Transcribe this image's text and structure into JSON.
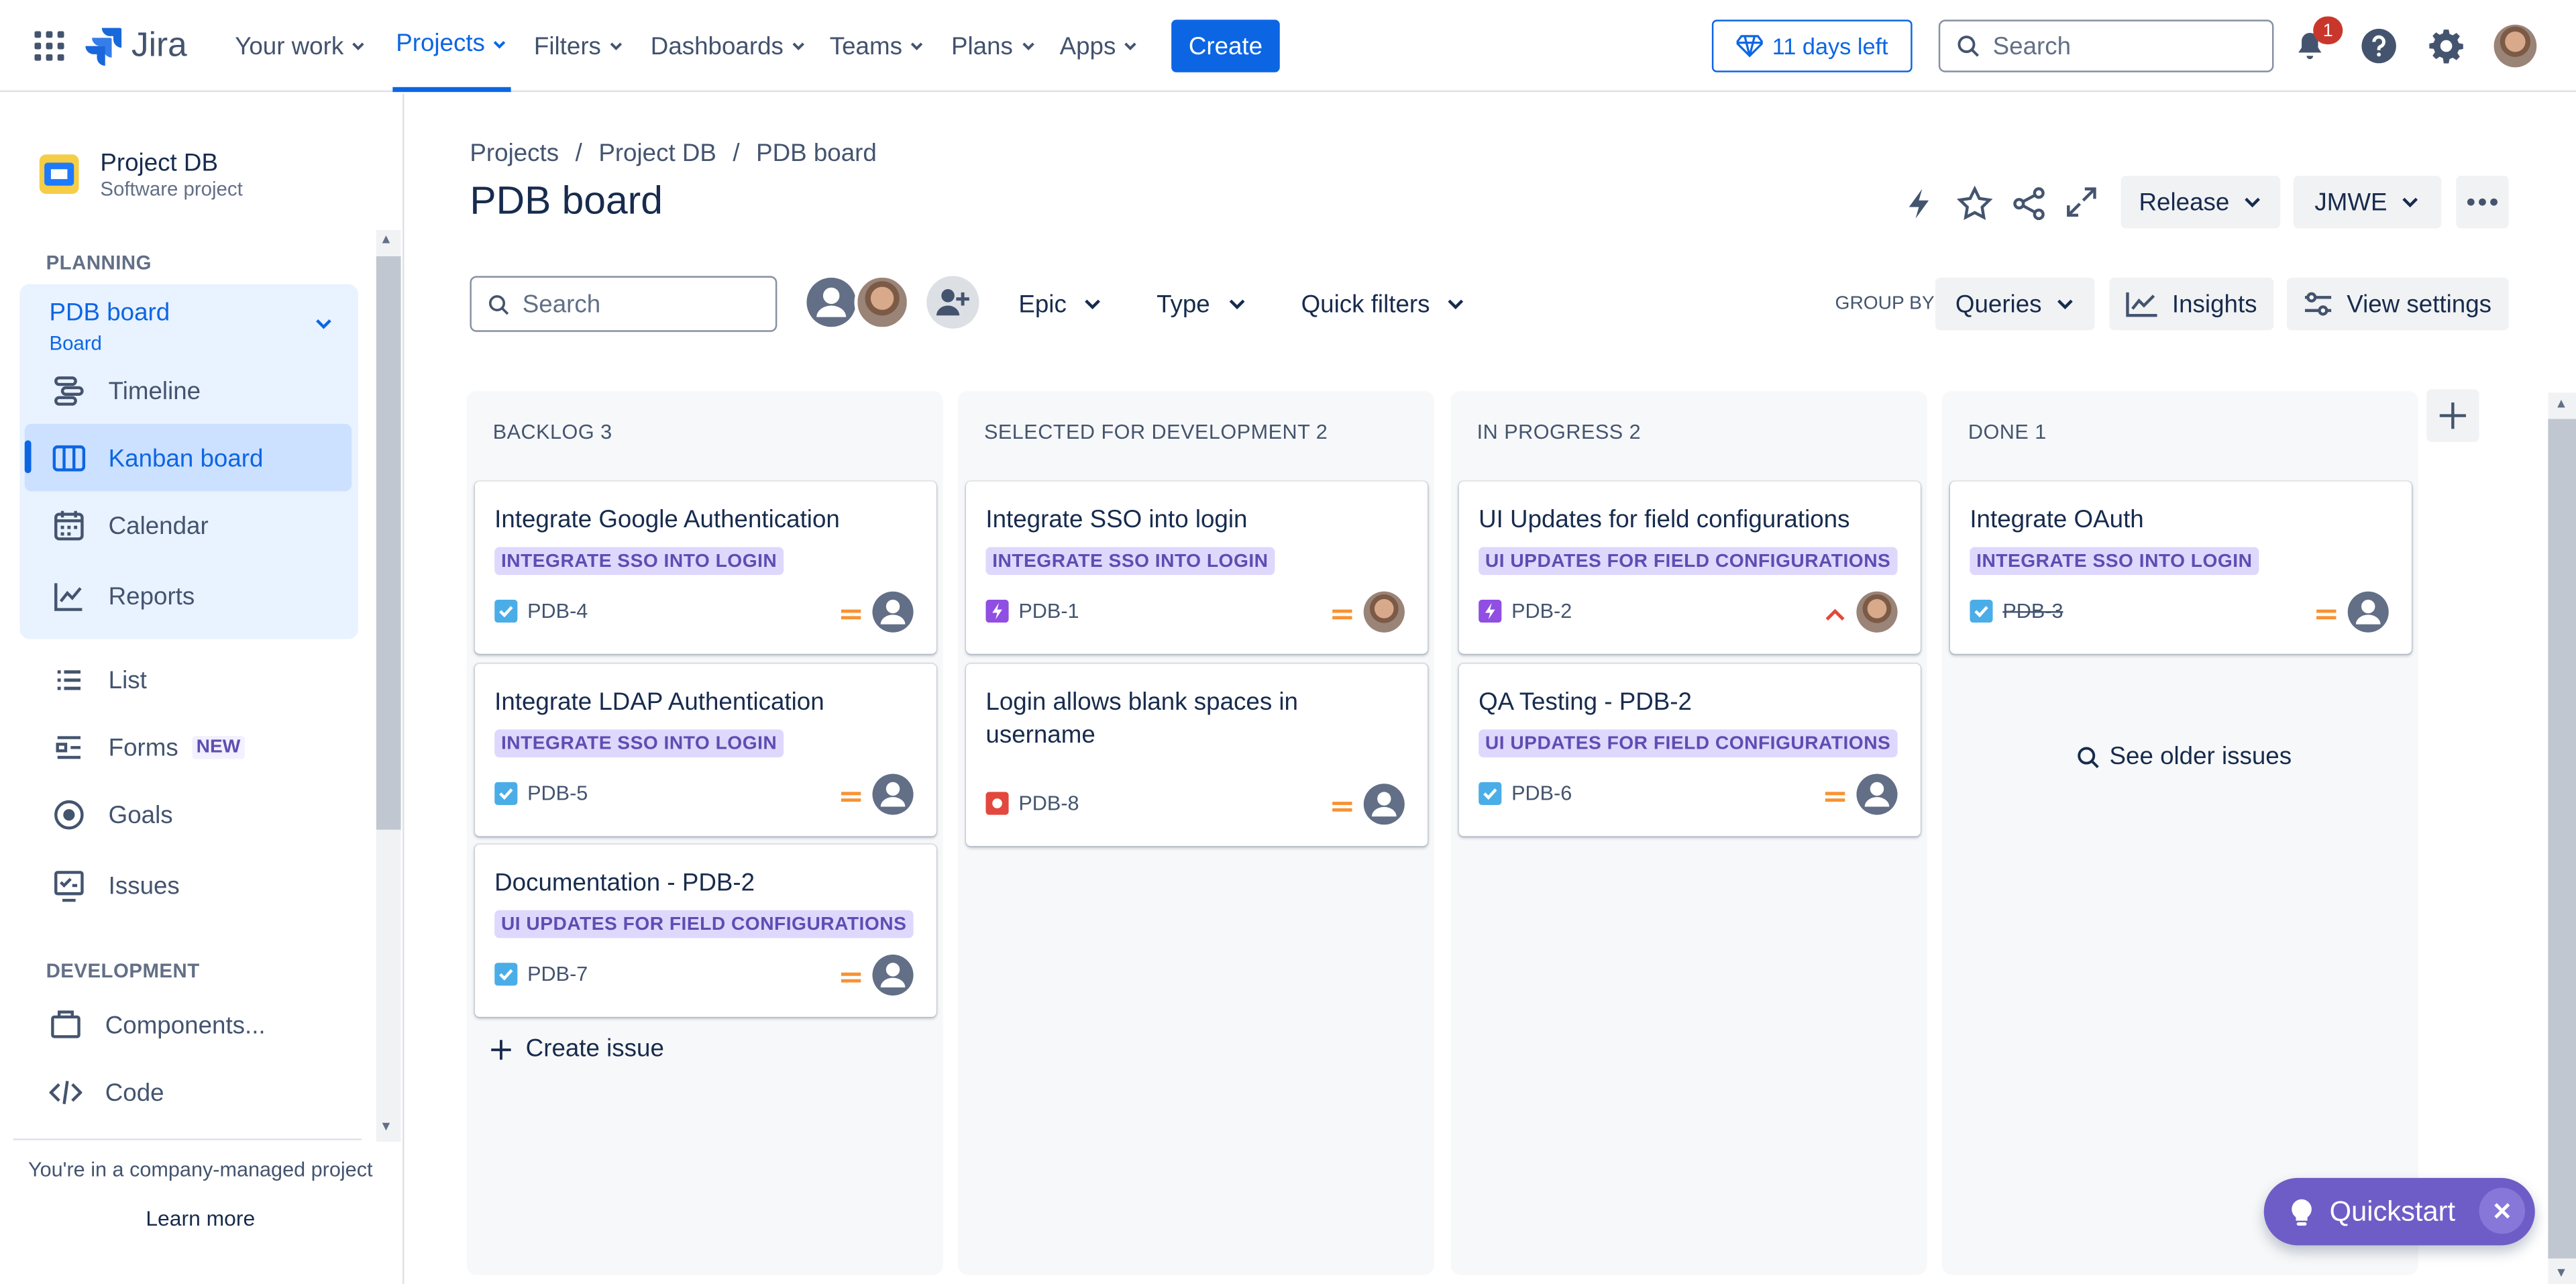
{
  "topnav": {
    "product": "Jira",
    "items": [
      "Your work",
      "Projects",
      "Filters",
      "Dashboards",
      "Teams",
      "Plans",
      "Apps"
    ],
    "create": "Create",
    "trial": "11 days left",
    "search_placeholder": "Search",
    "notification_count": "1"
  },
  "sidebar": {
    "project_name": "Project DB",
    "project_type": "Software project",
    "planning_header": "PLANNING",
    "board_name": "PDB board",
    "board_sub": "Board",
    "planning_items": [
      "Timeline",
      "Kanban board",
      "Calendar",
      "Reports"
    ],
    "items": [
      "List",
      "Forms",
      "Goals",
      "Issues"
    ],
    "forms_badge": "NEW",
    "dev_header": "DEVELOPMENT",
    "dev_items": [
      "Components...",
      "Code"
    ],
    "footer_text": "You're in a company-managed project",
    "learn_more": "Learn more"
  },
  "header": {
    "breadcrumb": [
      "Projects",
      "Project DB",
      "PDB board"
    ],
    "title": "PDB board",
    "release": "Release",
    "jmwe": "JMWE"
  },
  "filters": {
    "search_placeholder": "Search",
    "epic": "Epic",
    "type": "Type",
    "quick": "Quick filters",
    "group_by_label": "GROUP BY",
    "group_by_value": "Queries",
    "insights": "Insights",
    "view_settings": "View settings"
  },
  "columns": [
    {
      "header": "BACKLOG 3",
      "cards": [
        {
          "title": "Integrate Google Authentication",
          "epic": "INTEGRATE SSO INTO LOGIN",
          "key": "PDB-4",
          "type": "task",
          "priority": "medium",
          "assignee": "unassigned"
        },
        {
          "title": "Integrate LDAP Authentication",
          "epic": "INTEGRATE SSO INTO LOGIN",
          "key": "PDB-5",
          "type": "task",
          "priority": "medium",
          "assignee": "unassigned"
        },
        {
          "title": "Documentation - PDB-2",
          "epic": "UI UPDATES FOR FIELD CONFIGURATIONS",
          "key": "PDB-7",
          "type": "task",
          "priority": "medium",
          "assignee": "unassigned"
        }
      ],
      "create_issue": "Create issue"
    },
    {
      "header": "SELECTED FOR DEVELOPMENT 2",
      "cards": [
        {
          "title": "Integrate SSO into login",
          "epic": "INTEGRATE SSO INTO LOGIN",
          "key": "PDB-1",
          "type": "epic",
          "priority": "medium",
          "assignee": "user"
        },
        {
          "title": "Login allows blank spaces in username",
          "epic": "",
          "key": "PDB-8",
          "type": "bug",
          "priority": "medium",
          "assignee": "unassigned"
        }
      ]
    },
    {
      "header": "IN PROGRESS 2",
      "cards": [
        {
          "title": "UI Updates for field configurations",
          "epic": "UI UPDATES FOR FIELD CONFIGURATIONS",
          "key": "PDB-2",
          "type": "epic",
          "priority": "high",
          "assignee": "user"
        },
        {
          "title": "QA Testing - PDB-2",
          "epic": "UI UPDATES FOR FIELD CONFIGURATIONS",
          "key": "PDB-6",
          "type": "task",
          "priority": "medium",
          "assignee": "unassigned"
        }
      ]
    },
    {
      "header": "DONE 1",
      "cards": [
        {
          "title": "Integrate OAuth",
          "epic": "INTEGRATE SSO INTO LOGIN",
          "key": "PDB-3",
          "type": "task",
          "priority": "medium",
          "assignee": "unassigned"
        }
      ],
      "see_older": "See older issues"
    }
  ],
  "quickstart": "Quickstart",
  "colors": {
    "accent": "#0c66e4",
    "epic_bg": "#dfd8fd",
    "epic_text": "#5e4db2",
    "quickstart": "#6e5dc6"
  }
}
